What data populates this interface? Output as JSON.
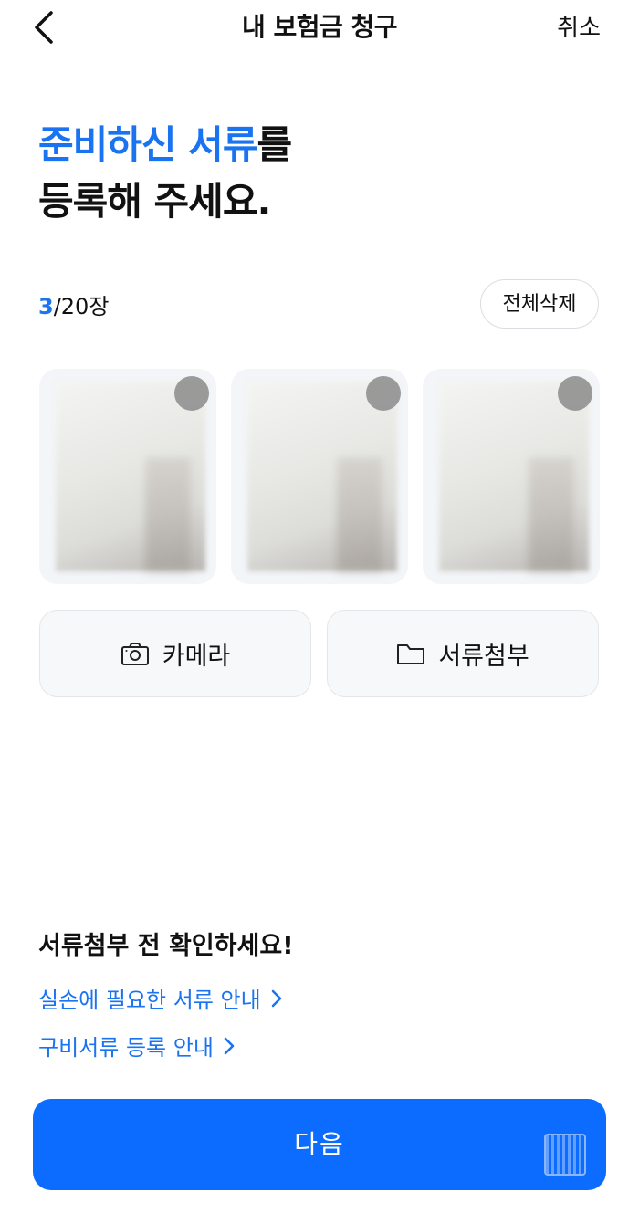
{
  "header": {
    "title": "내 보험금 청구",
    "cancel_label": "취소"
  },
  "heading": {
    "line1_highlight": "준비하신 서류",
    "line1_rest": "를",
    "line2": "등록해 주세요."
  },
  "counter": {
    "current": "3",
    "total": "/20장"
  },
  "delete_all_label": "전체삭제",
  "thumbnails": [
    {
      "name": "document-1"
    },
    {
      "name": "document-2"
    },
    {
      "name": "document-3"
    }
  ],
  "actions": {
    "camera_label": "카메라",
    "attach_label": "서류첨부"
  },
  "info": {
    "title": "서류첨부 전 확인하세요!",
    "link1": "실손에 필요한 서류 안내",
    "link2": "구비서류 등록 안내"
  },
  "next_label": "다음",
  "colors": {
    "accent": "#1a73f0",
    "button": "#0b6cff"
  }
}
